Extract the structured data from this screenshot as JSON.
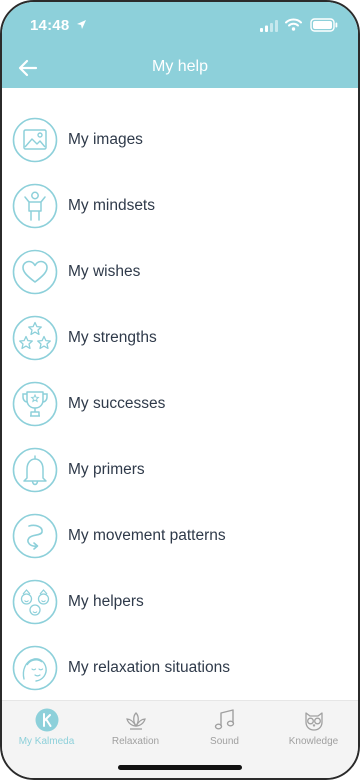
{
  "status": {
    "time": "14:48"
  },
  "header": {
    "title": "My help"
  },
  "items": [
    {
      "label": "My images",
      "icon": "images-icon"
    },
    {
      "label": "My mindsets",
      "icon": "person-icon"
    },
    {
      "label": "My wishes",
      "icon": "heart-icon"
    },
    {
      "label": "My strengths",
      "icon": "stars-icon"
    },
    {
      "label": "My successes",
      "icon": "trophy-icon"
    },
    {
      "label": "My primers",
      "icon": "bell-icon"
    },
    {
      "label": "My movement patterns",
      "icon": "movement-icon"
    },
    {
      "label": "My helpers",
      "icon": "helpers-icon"
    },
    {
      "label": "My relaxation situations",
      "icon": "relax-face-icon"
    }
  ],
  "tabs": [
    {
      "label": "My Kalmeda",
      "active": true
    },
    {
      "label": "Relaxation",
      "active": false
    },
    {
      "label": "Sound",
      "active": false
    },
    {
      "label": "Knowledge",
      "active": false
    }
  ],
  "colors": {
    "accent": "#8dd0da",
    "text": "#2f3a4a",
    "tab_inactive": "#a0a0a0"
  }
}
